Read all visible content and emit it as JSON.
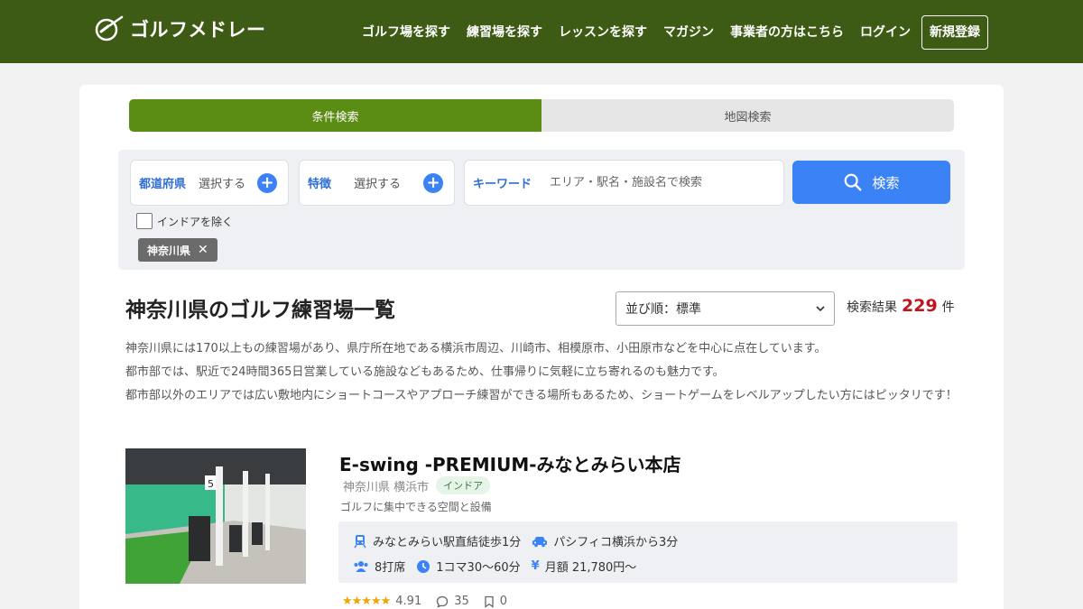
{
  "header": {
    "logo_text": "ゴルフメドレー",
    "nav": [
      {
        "label": "ゴルフ場を探す"
      },
      {
        "label": "練習場を探す"
      },
      {
        "label": "レッスンを探す"
      },
      {
        "label": "マガジン"
      },
      {
        "label": "事業者の方はこちら"
      },
      {
        "label": "ログイン"
      }
    ],
    "register_label": "新規登録",
    "bg_color": "#3e5b15"
  },
  "tabs": [
    {
      "label": "条件検索",
      "active": true
    },
    {
      "label": "地図検索",
      "active": false
    }
  ],
  "search": {
    "prefecture_label": "都道府県",
    "prefecture_value": "選択する",
    "feature_label": "特徴",
    "feature_value": "選択する",
    "keyword_label": "キーワード",
    "keyword_placeholder": "エリア・駅名・施設名で検索",
    "button_label": "検索",
    "indoor_exclude_label": "インドアを除く",
    "indoor_exclude_checked": false,
    "selected_chip": "神奈川県"
  },
  "results": {
    "title": "神奈川県のゴルフ練習場一覧",
    "sort_label": "並び順：標準",
    "count_label": "検索結果",
    "count": "229",
    "count_unit": "件"
  },
  "description": [
    "神奈川県には170以上もの練習場があり、県庁所在地である横浜市周辺、川崎市、相模原市、小田原市などを中心に点在しています。",
    "都市部では、駅近で24時間365日営業している施設などもあるため、仕事帰りに気軽に立ち寄れるのも魅力です。",
    "都市部以外のエリアでは広い敷地内にショートコースやアプローチ練習ができる場所もあるため、ショートゲームをレベルアップしたい方にはピッタリです！"
  ],
  "facility": {
    "name": "E-swing -PREMIUM-みなとみらい本店",
    "location": "神奈川県 横浜市",
    "tag": "インドア",
    "catch": "ゴルフに集中できる空間と設備",
    "access_train": "みなとみらい駅直結徒歩1分",
    "access_car": "パシフィコ横浜から3分",
    "seats": "8打席",
    "time": "1コマ30〜60分",
    "price_icon": "¥",
    "price": "月額 21,780円〜",
    "stars": "★★★★★",
    "rating": "4.91",
    "comments": "35",
    "bookmarks": "0"
  },
  "colors": {
    "accent_blue": "#3b82f6",
    "tab_green": "#5b8c14",
    "count_red": "#c0151f"
  }
}
